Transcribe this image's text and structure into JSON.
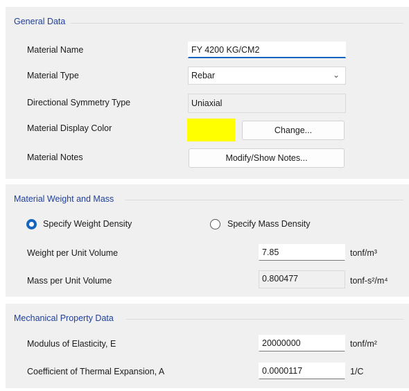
{
  "general": {
    "title": "General Data",
    "material_name_label": "Material Name",
    "material_name_value": "FY 4200 KG/CM2",
    "material_type_label": "Material Type",
    "material_type_value": "Rebar",
    "symmetry_label": "Directional Symmetry Type",
    "symmetry_value": "Uniaxial",
    "display_color_label": "Material Display Color",
    "display_color": "#ffff00",
    "change_button": "Change...",
    "notes_label": "Material Notes",
    "notes_button": "Modify/Show Notes..."
  },
  "weight": {
    "title": "Material Weight and Mass",
    "radio_weight_label": "Specify Weight Density",
    "radio_weight_checked": true,
    "radio_mass_label": "Specify Mass Density",
    "radio_mass_checked": false,
    "weight_label": "Weight per Unit Volume",
    "weight_value": "7.85",
    "weight_unit": "tonf/m³",
    "mass_label": "Mass per Unit Volume",
    "mass_value": "0.800477",
    "mass_unit": "tonf-s²/m⁴"
  },
  "mechanical": {
    "title": "Mechanical Property Data",
    "modulus_label": "Modulus of Elasticity,  E",
    "modulus_value": "20000000",
    "modulus_unit": "tonf/m²",
    "thermal_label": "Coefficient of Thermal Expansion,  A",
    "thermal_value": "0.0000117",
    "thermal_unit": "1/C"
  },
  "colors": {
    "accent": "#1565c0",
    "group_title": "#1f3f9a",
    "panel_bg": "#f0f0f0",
    "swatch": "#ffff00"
  }
}
